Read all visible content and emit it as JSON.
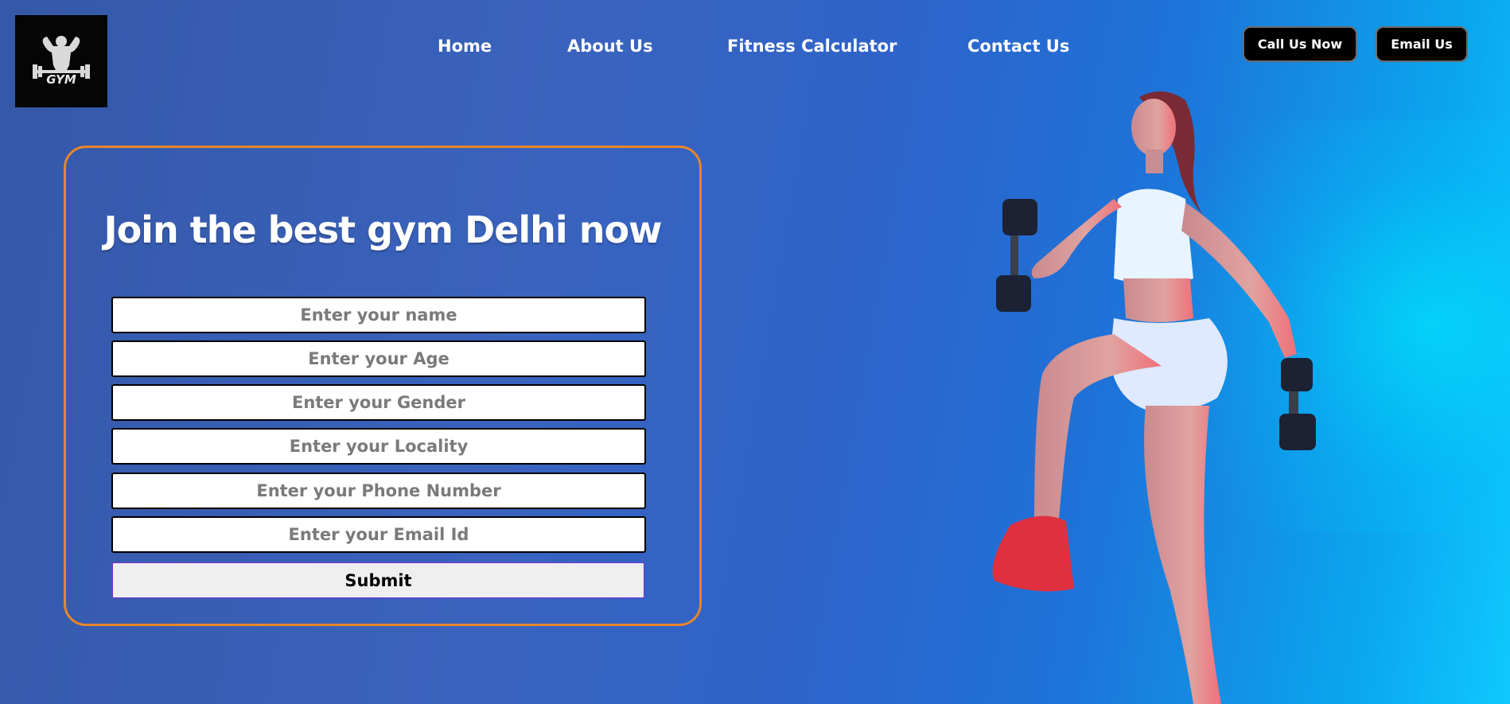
{
  "logo": {
    "text": "GYM",
    "icon": "gym-logo-icon"
  },
  "nav": {
    "home": "Home",
    "about": "About Us",
    "calculator": "Fitness Calculator",
    "contact": "Contact Us"
  },
  "actions": {
    "call": "Call Us Now",
    "email": "Email Us"
  },
  "form": {
    "title": "Join the best gym Delhi now",
    "fields": [
      {
        "placeholder": "Enter your name"
      },
      {
        "placeholder": "Enter your Age"
      },
      {
        "placeholder": "Enter your Gender"
      },
      {
        "placeholder": "Enter your Locality"
      },
      {
        "placeholder": "Enter your Phone Number"
      },
      {
        "placeholder": "Enter your Email Id"
      }
    ],
    "submit": "Submit"
  },
  "colors": {
    "card_border": "#e8862a",
    "button_bg": "#000000",
    "background_start": "#3558a8",
    "background_end": "#10c8ff"
  },
  "hero_image": "woman-with-dumbbells-image"
}
